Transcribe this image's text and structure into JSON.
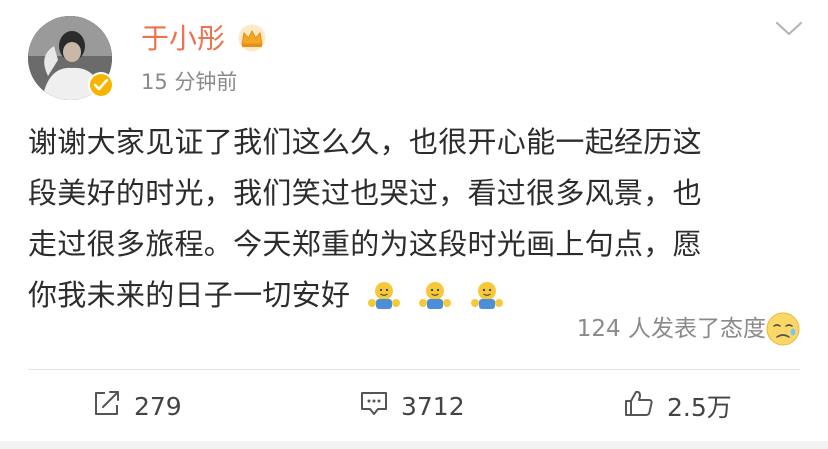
{
  "post": {
    "author": "于小彤",
    "time": "15 分钟前",
    "lines": [
      "谢谢大家见证了我们这么久，也很开心能一起经历这",
      "段美好的时光，我们笑过也哭过，看过很多风景，也",
      "走过很多旅程。今天郑重的为这段时光画上句点，愿",
      "你我未来的日子一切安好"
    ],
    "reaction_summary": "124 人发表了态度"
  },
  "actions": {
    "repost_count": "279",
    "comment_count": "3712",
    "like_count": "2.5万"
  },
  "colors": {
    "username": "#eb7350",
    "verified_badge": "#f7b500",
    "crown": "#f5a623",
    "muted_text": "#8a8a8a"
  },
  "icons": [
    "crown-icon",
    "verified-badge-icon",
    "chevron-down-icon",
    "hug-emoji-icon",
    "sad-face-emoji-icon",
    "repost-icon",
    "comment-icon",
    "thumbs-up-icon"
  ]
}
